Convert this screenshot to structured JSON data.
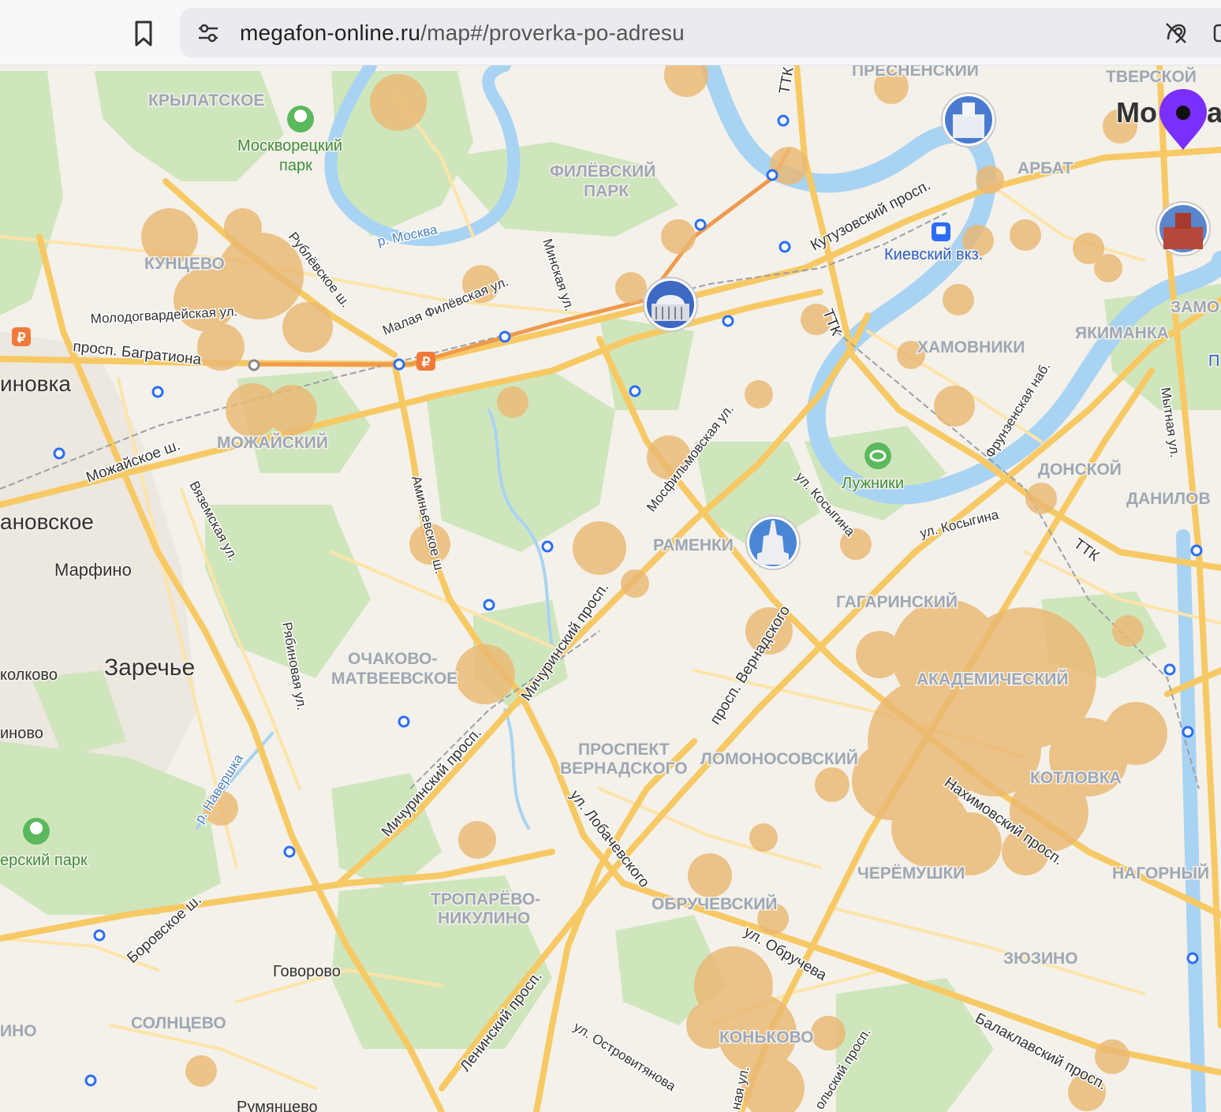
{
  "browser": {
    "url_domain": "megafon-online.ru",
    "url_path": "/map#/proverka-po-adresu",
    "icons": [
      "bookmark-icon",
      "site-settings-icon",
      "tracking-protection-icon"
    ]
  },
  "map": {
    "colors": {
      "land": "#f4f1ea",
      "park": "#cfe6bd",
      "water": "#a9d3f2",
      "road_major": "#f7c965",
      "road_minor": "#fde4a8",
      "coverage": "#eab873",
      "metro_line": "#ef9a4c",
      "marker": "#7b2fff",
      "station": "#2b6ef5",
      "district_label": "#9ea7b3",
      "place_label": "#333333"
    },
    "districts": [
      {
        "name": "ПРЕСНЕНСКИЙ"
      },
      {
        "name": "ТВЕРСКОЙ"
      },
      {
        "name": "КРЫЛАТСКОЕ"
      },
      {
        "name": "ФИЛЁВСКИЙ"
      },
      {
        "name": "ПАРК"
      },
      {
        "name": "АРБАТ"
      },
      {
        "name": "КУНЦЕВО"
      },
      {
        "name": "ЗАМО"
      },
      {
        "name": "ХАМОВНИКИ"
      },
      {
        "name": "ЯКИМАНКА"
      },
      {
        "name": "МОЖАЙСКИЙ"
      },
      {
        "name": "ДОНСКОЙ"
      },
      {
        "name": "ДАНИЛОВ"
      },
      {
        "name": "РАМЕНКИ"
      },
      {
        "name": "ГАГАРИНСКИЙ"
      },
      {
        "name": "ОЧАКОВО-"
      },
      {
        "name": "МАТВЕЕВСКОЕ"
      },
      {
        "name": "АКАДЕМИЧЕСКИЙ"
      },
      {
        "name": "ПРОСПЕКТ"
      },
      {
        "name": "ВЕРНАДСКОГО"
      },
      {
        "name": "ЛОМОНОСОВСКИЙ"
      },
      {
        "name": "КОТЛОВКА"
      },
      {
        "name": "ЧЕРЁМУШКИ"
      },
      {
        "name": "НАГОРНЫЙ"
      },
      {
        "name": "ТРОПАРЁВО-"
      },
      {
        "name": "НИКУЛИНО"
      },
      {
        "name": "ОБРУЧЕВСКИЙ"
      },
      {
        "name": "ЗЮЗИНО"
      },
      {
        "name": "СОЛНЦЕВО"
      },
      {
        "name": "КОНЬКОВО"
      },
      {
        "name": "ИНО"
      }
    ],
    "places": [
      {
        "name": "Москворецкий"
      },
      {
        "name": "парк"
      },
      {
        "name": "Мо"
      },
      {
        "name": "а"
      },
      {
        "name": "Киевский вкз."
      },
      {
        "name": "иновка"
      },
      {
        "name": "ановское"
      },
      {
        "name": "Марфино"
      },
      {
        "name": "Лужники"
      },
      {
        "name": "Заречье"
      },
      {
        "name": "колково"
      },
      {
        "name": "инoво"
      },
      {
        "name": "ерский парк"
      },
      {
        "name": "Говорово"
      },
      {
        "name": "Румянцево"
      },
      {
        "name": "П"
      }
    ],
    "streets": [
      {
        "name": "Рублёвское ш."
      },
      {
        "name": "р. Москва"
      },
      {
        "name": "Малая Филёвская ул."
      },
      {
        "name": "Минская ул."
      },
      {
        "name": "Молодогвардейская ул."
      },
      {
        "name": "просп. Багратиона"
      },
      {
        "name": "Кутузовский просп."
      },
      {
        "name": "ТТК"
      },
      {
        "name": "ТТК"
      },
      {
        "name": "ТТК"
      },
      {
        "name": "Мосфильмовская ул."
      },
      {
        "name": "Можайское ш."
      },
      {
        "name": "Вяземская ул."
      },
      {
        "name": "Аминьевское ш."
      },
      {
        "name": "ул. Косыгина"
      },
      {
        "name": "ул. Косыгина"
      },
      {
        "name": "Фрунзенская наб."
      },
      {
        "name": "Мытная ул."
      },
      {
        "name": "Мичуринский просп."
      },
      {
        "name": "Рябиновая ул."
      },
      {
        "name": "просп. Вернадского"
      },
      {
        "name": "р. Навершка"
      },
      {
        "name": "Мичуринский просп."
      },
      {
        "name": "ул. Лобачевского"
      },
      {
        "name": "Нахимовский просп."
      },
      {
        "name": "Боровское ш."
      },
      {
        "name": "ул. Обручева"
      },
      {
        "name": "Ленинский просп."
      },
      {
        "name": "ул. Островитянова"
      },
      {
        "name": "Балаклавский просп."
      },
      {
        "name": "ольский просп."
      },
      {
        "name": "ная ул."
      }
    ]
  }
}
